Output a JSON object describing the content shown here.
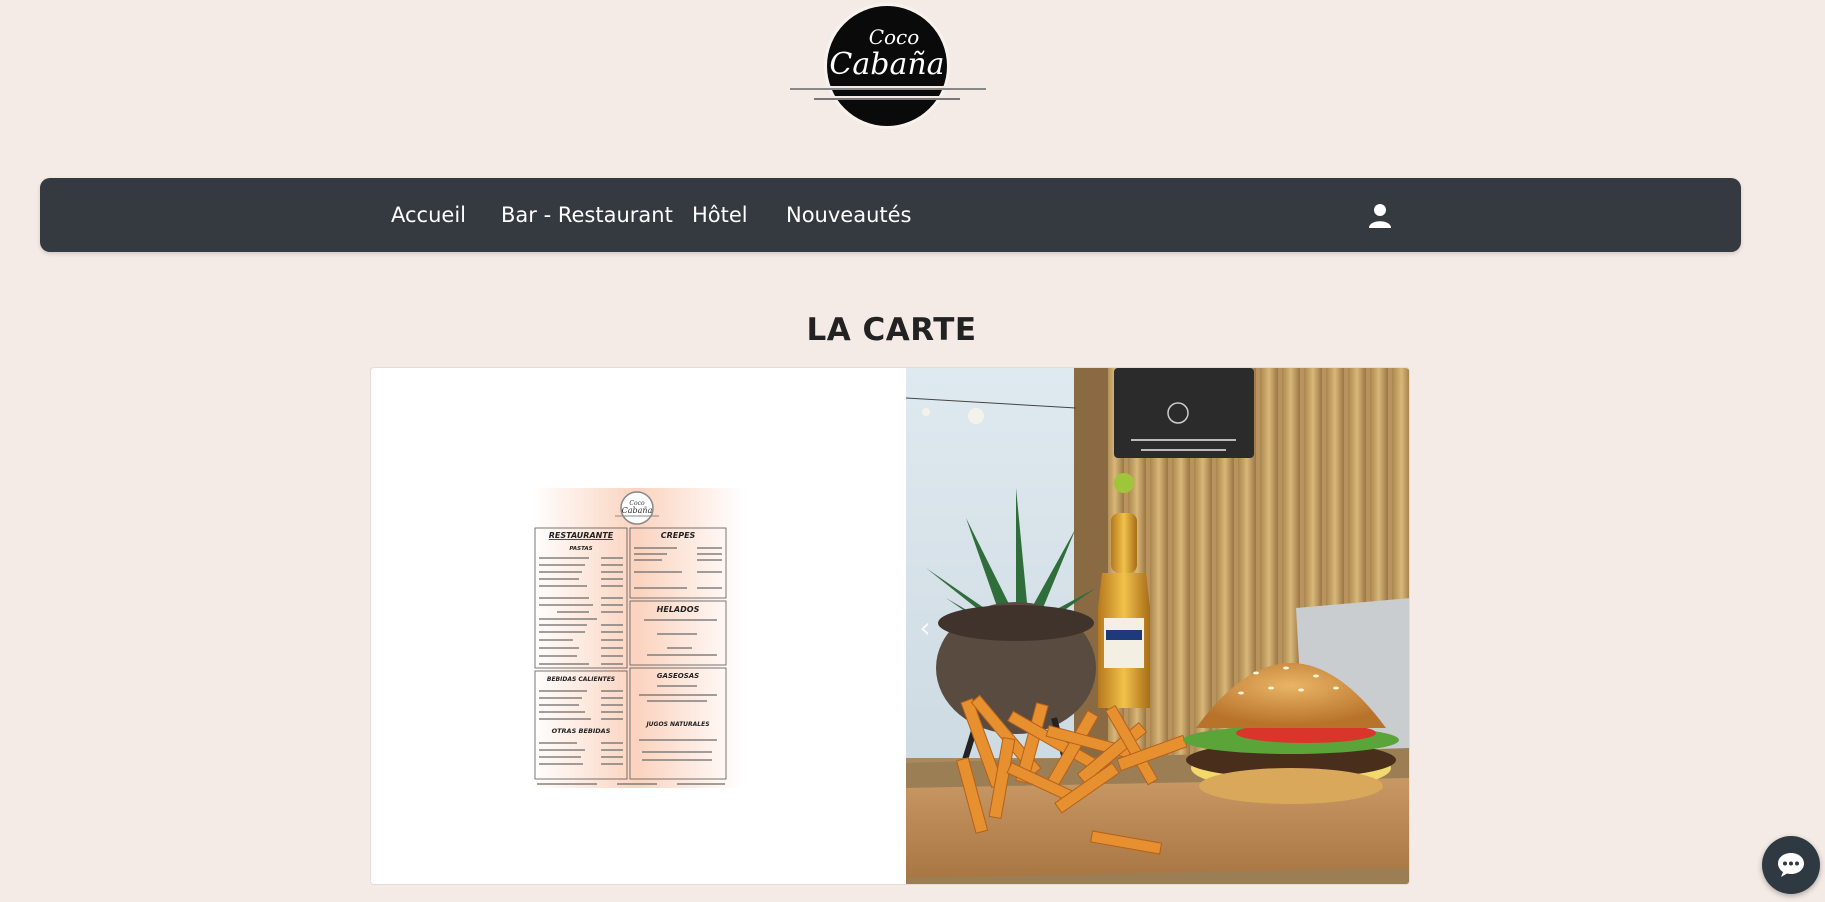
{
  "brand": {
    "logo_line1": "Coco",
    "logo_line2": "Cabaña"
  },
  "nav": {
    "items": [
      {
        "label": "Accueil"
      },
      {
        "label": "Bar - Restaurant"
      },
      {
        "label": "Hôtel"
      },
      {
        "label": "Nouveautés"
      }
    ],
    "user_icon": "user-icon"
  },
  "main": {
    "title": "LA CARTE",
    "carousel_prev_glyph": "‹"
  },
  "menu_card": {
    "logo_line1": "Coco",
    "logo_line2": "Cabaña",
    "sections": {
      "restaurant": "RESTAURANTE",
      "pastas": "PASTAS",
      "crepes": "CREPES",
      "helados": "HELADOS",
      "bebidas_calientes": "BEBIDAS CALIENTES",
      "gaseosas": "GASEOSAS",
      "otras_bebidas": "OTRAS BEBIDAS",
      "jugos_naturales": "JUGOS NATURALES"
    }
  },
  "colors": {
    "page_bg": "#f5ebe6",
    "navbar_bg": "#343a40",
    "nav_text": "#ffffff",
    "title_text": "#222222",
    "chat_bg": "#2f3942"
  },
  "widgets": {
    "chat_icon": "chat-bubble-icon"
  }
}
